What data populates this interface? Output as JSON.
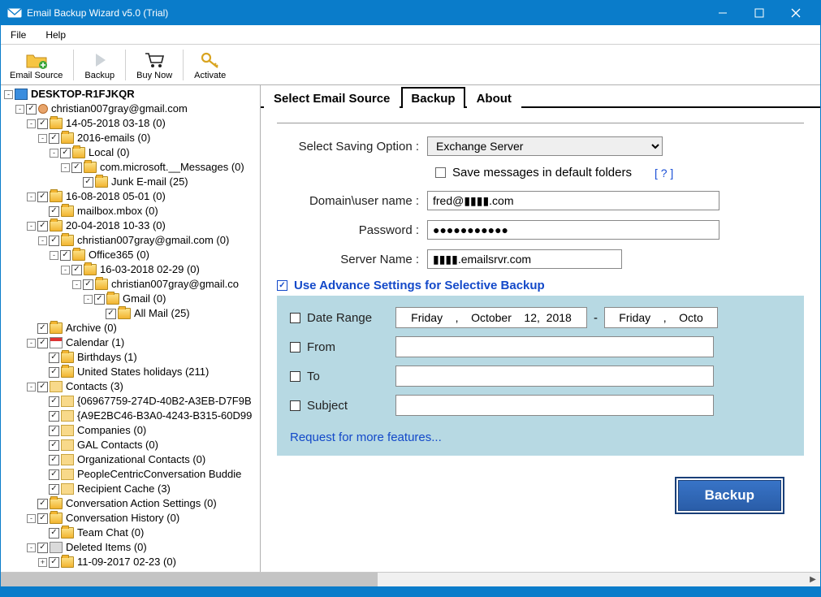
{
  "window": {
    "title": "Email Backup Wizard v5.0 (Trial)"
  },
  "menu": {
    "file": "File",
    "help": "Help"
  },
  "toolbar": {
    "email_source": "Email Source",
    "backup": "Backup",
    "buy_now": "Buy Now",
    "activate": "Activate"
  },
  "tree": {
    "root": "DESKTOP-R1FJKQR",
    "n_account": "christian007gray@gmail.com",
    "n_140518": "14-05-2018 03-18  (0)",
    "n_2016emails": "2016-emails  (0)",
    "n_local": "Local  (0)",
    "n_commsgs": "com.microsoft.__Messages  (0)",
    "n_junk": "Junk E-mail (25)",
    "n_160818": "16-08-2018 05-01  (0)",
    "n_mailboxmbox": "mailbox.mbox  (0)",
    "n_200418": "20-04-2018 10-33  (0)",
    "n_account2": "christian007gray@gmail.com  (0)",
    "n_office365": "Office365  (0)",
    "n_160318": "16-03-2018 02-29  (0)",
    "n_account3": "christian007gray@gmail.co",
    "n_gmail": "Gmail  (0)",
    "n_allmail": "All Mail (25)",
    "n_archive": "Archive (0)",
    "n_calendar": "Calendar (1)",
    "n_birthdays": "Birthdays (1)",
    "n_usholidays": "United States holidays (211)",
    "n_contacts": "Contacts (3)",
    "n_c1": "{06967759-274D-40B2-A3EB-D7F9B",
    "n_c2": "{A9E2BC46-B3A0-4243-B315-60D99",
    "n_companies": "Companies (0)",
    "n_gal": "GAL Contacts (0)",
    "n_orgcontacts": "Organizational Contacts (0)",
    "n_pccb": "PeopleCentricConversation Buddie",
    "n_recipcache": "Recipient Cache (3)",
    "n_convactset": "Conversation Action Settings (0)",
    "n_convhist": "Conversation History (0)",
    "n_teamchat": "Team Chat (0)",
    "n_deleted": "Deleted Items (0)",
    "n_110917": "11-09-2017 02-23  (0)"
  },
  "tabs": {
    "t1": "Select Email Source",
    "t2": "Backup",
    "t3": "About"
  },
  "form": {
    "saving_label": "Select Saving Option :",
    "saving_value": "Exchange Server",
    "save_default": "Save messages in default folders",
    "help_link": "[  ?  ]",
    "domain_label": "Domain\\user name :",
    "domain_value": "fred@▮▮▮▮.com",
    "password_label": "Password :",
    "password_value": "●●●●●●●●●●●",
    "server_label": "Server Name :",
    "server_value": "▮▮▮▮.emailsrvr.com",
    "advance_label": "Use Advance Settings for Selective Backup",
    "date_range": "Date Range",
    "date_from": "Friday    ,    October    12,  2018",
    "date_to": "Friday    ,    Octo",
    "from": "From",
    "to": "To",
    "subject": "Subject",
    "request_more": "Request for more features...",
    "backup_btn": "Backup"
  }
}
